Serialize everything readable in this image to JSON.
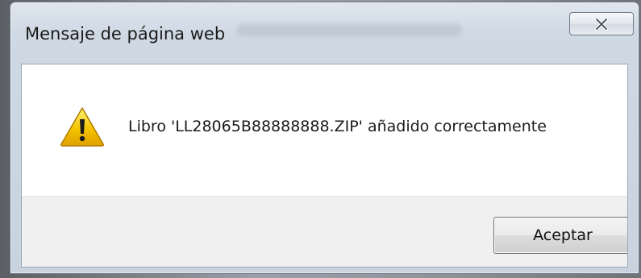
{
  "dialog": {
    "title": "Mensaje de página web",
    "close_icon": "close-icon",
    "warning_icon": "warning-icon",
    "message": "Libro 'LL28065B88888888.ZIP' añadido correctamente",
    "ok_label": "Aceptar"
  },
  "colors": {
    "frame": "#cfd9e4",
    "content_bg": "#ffffff",
    "footer_bg": "#f0f0f0",
    "warning_fill": "#f5c400"
  }
}
